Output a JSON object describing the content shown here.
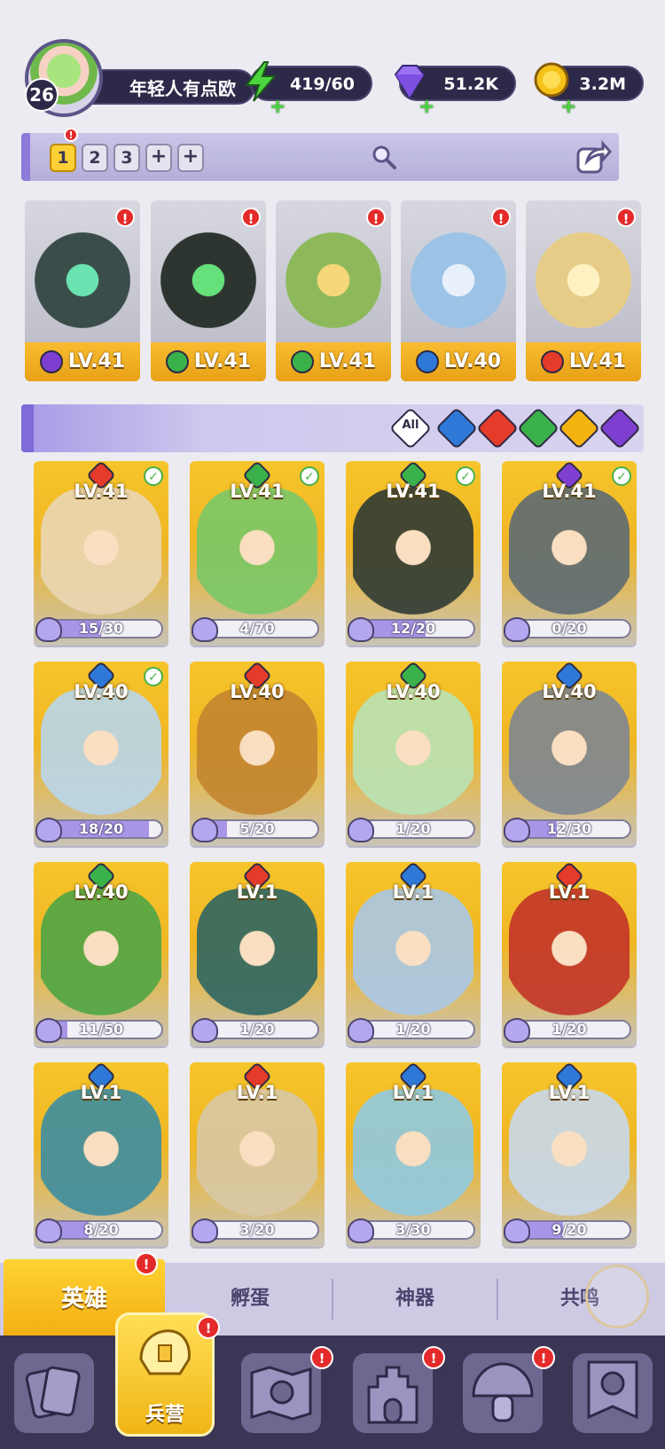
{
  "player": {
    "level": "26",
    "name": "年轻人有点欧"
  },
  "resources": [
    {
      "name": "energy",
      "icon": "lightning-icon",
      "value": "419/60",
      "color": "#4cd43f"
    },
    {
      "name": "gems",
      "icon": "diamond-icon",
      "value": "51.2K",
      "color": "#9a72f0"
    },
    {
      "name": "coins",
      "icon": "coin-icon",
      "value": "3.2M",
      "color": "#f4c219"
    }
  ],
  "team_tabs": [
    "1",
    "2",
    "3",
    "+",
    "+"
  ],
  "team_heroes": [
    {
      "element": "dark",
      "level": "LV.41"
    },
    {
      "element": "wood",
      "level": "LV.41"
    },
    {
      "element": "wood",
      "level": "LV.41"
    },
    {
      "element": "water",
      "level": "LV.40"
    },
    {
      "element": "fire",
      "level": "LV.41"
    }
  ],
  "filters": [
    {
      "label": "All",
      "icon": "all-filter-icon"
    },
    {
      "label": "",
      "icon": "water-element-icon"
    },
    {
      "label": "",
      "icon": "fire-element-icon"
    },
    {
      "label": "",
      "icon": "wood-element-icon"
    },
    {
      "label": "",
      "icon": "light-element-icon"
    },
    {
      "label": "",
      "icon": "dark-element-icon"
    }
  ],
  "heroes": [
    {
      "element": "fire",
      "level": "LV.41",
      "progress": "15/30",
      "fraction": 0.5,
      "checked": true,
      "art": "#e9d6b3"
    },
    {
      "element": "wood",
      "level": "LV.41",
      "progress": "4/70",
      "fraction": 0.057,
      "checked": true,
      "art": "#7ac868"
    },
    {
      "element": "wood",
      "level": "LV.41",
      "progress": "12/20",
      "fraction": 0.6,
      "checked": true,
      "art": "#2f3a33"
    },
    {
      "element": "dark",
      "level": "LV.41",
      "progress": "0/20",
      "fraction": 0,
      "checked": true,
      "art": "#5d6b73"
    },
    {
      "element": "water",
      "level": "LV.40",
      "progress": "18/20",
      "fraction": 0.9,
      "checked": true,
      "art": "#b9d6ea"
    },
    {
      "element": "fire",
      "level": "LV.40",
      "progress": "5/20",
      "fraction": 0.25,
      "checked": false,
      "art": "#c3852f"
    },
    {
      "element": "wood",
      "level": "LV.40",
      "progress": "1/20",
      "fraction": 0.05,
      "checked": false,
      "art": "#b9e3b4"
    },
    {
      "element": "water",
      "level": "LV.40",
      "progress": "12/30",
      "fraction": 0.4,
      "checked": false,
      "art": "#7e8691"
    },
    {
      "element": "wood",
      "level": "LV.40",
      "progress": "11/50",
      "fraction": 0.22,
      "checked": false,
      "art": "#4fa545"
    },
    {
      "element": "fire",
      "level": "LV.1",
      "progress": "1/20",
      "fraction": 0.05,
      "checked": false,
      "art": "#2e6662"
    },
    {
      "element": "water",
      "level": "LV.1",
      "progress": "1/20",
      "fraction": 0.05,
      "checked": false,
      "art": "#a9c8e6"
    },
    {
      "element": "fire",
      "level": "LV.1",
      "progress": "1/20",
      "fraction": 0.05,
      "checked": false,
      "art": "#c23428"
    },
    {
      "element": "water",
      "level": "LV.1",
      "progress": "8/20",
      "fraction": 0.4,
      "checked": false,
      "art": "#3d8da0"
    },
    {
      "element": "fire",
      "level": "LV.1",
      "progress": "3/20",
      "fraction": 0.15,
      "checked": false,
      "art": "#d8c8a4"
    },
    {
      "element": "water",
      "level": "LV.1",
      "progress": "3/30",
      "fraction": 0.1,
      "checked": false,
      "art": "#8fc9e0"
    },
    {
      "element": "water",
      "level": "LV.1",
      "progress": "9/20",
      "fraction": 0.45,
      "checked": false,
      "art": "#c8d9ec"
    }
  ],
  "sub_tabs": [
    {
      "label": "英雄",
      "active": true
    },
    {
      "label": "孵蛋",
      "active": false
    },
    {
      "label": "神器",
      "active": false
    },
    {
      "label": "共鸣",
      "active": false
    }
  ],
  "bottom_nav": [
    {
      "name": "cards",
      "icon": "cards-icon",
      "label": "",
      "badge": false
    },
    {
      "name": "barracks",
      "icon": "helmet-icon",
      "label": "兵营",
      "badge": true,
      "active": true
    },
    {
      "name": "map",
      "icon": "map-icon",
      "label": "",
      "badge": true
    },
    {
      "name": "castle",
      "icon": "castle-icon",
      "label": "",
      "badge": true
    },
    {
      "name": "mushroom",
      "icon": "mushroom-icon",
      "label": "",
      "badge": true
    },
    {
      "name": "guild",
      "icon": "banner-icon",
      "label": "",
      "badge": false
    }
  ],
  "colors": {
    "dark": "#7e3fd0",
    "wood": "#3ab14b",
    "water": "#2e79d8",
    "fire": "#e43b2a",
    "light": "#f4b40f"
  }
}
